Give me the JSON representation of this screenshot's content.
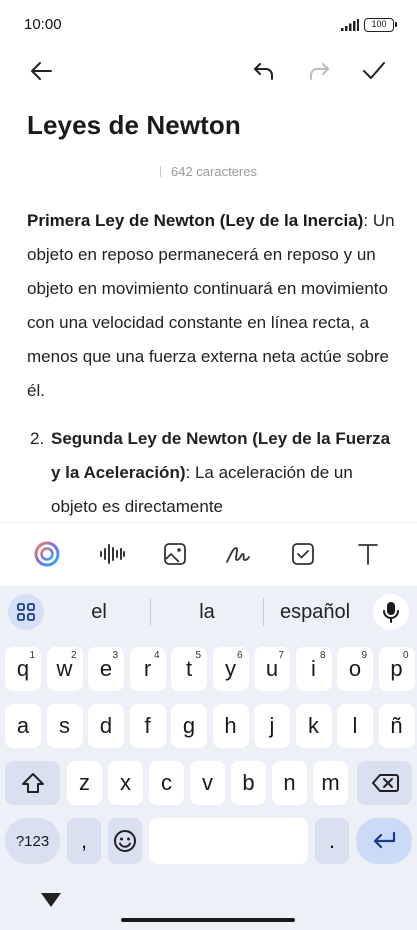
{
  "status": {
    "time": "10:00",
    "battery": "100"
  },
  "note": {
    "title": "Leyes de Newton",
    "char_count": "642 caracteres",
    "first_law_heading": "Primera Ley de Newton (Ley de la Inercia)",
    "first_law_colon": ":",
    "first_law_text": "Un objeto en reposo permanecerá en reposo y un objeto en movimiento continuará en movimiento con una velocidad constante en línea recta, a menos que una fuerza externa neta actúe sobre él.",
    "second_law_number": "2.",
    "second_law_heading": "Segunda Ley de Newton (Ley de la Fuerza y la Aceleración)",
    "second_law_text": ": La aceleración de un objeto es directamente"
  },
  "keyboard": {
    "suggestions": [
      "el",
      "la",
      "español"
    ],
    "row1": [
      {
        "k": "q",
        "s": "1"
      },
      {
        "k": "w",
        "s": "2"
      },
      {
        "k": "e",
        "s": "3"
      },
      {
        "k": "r",
        "s": "4"
      },
      {
        "k": "t",
        "s": "5"
      },
      {
        "k": "y",
        "s": "6"
      },
      {
        "k": "u",
        "s": "7"
      },
      {
        "k": "i",
        "s": "8"
      },
      {
        "k": "o",
        "s": "9"
      },
      {
        "k": "p",
        "s": "0"
      }
    ],
    "row2": [
      "a",
      "s",
      "d",
      "f",
      "g",
      "h",
      "j",
      "k",
      "l",
      "ñ"
    ],
    "row3": [
      "z",
      "x",
      "c",
      "v",
      "b",
      "n",
      "m"
    ],
    "sym_label": "?123",
    "comma": ",",
    "period": "."
  }
}
